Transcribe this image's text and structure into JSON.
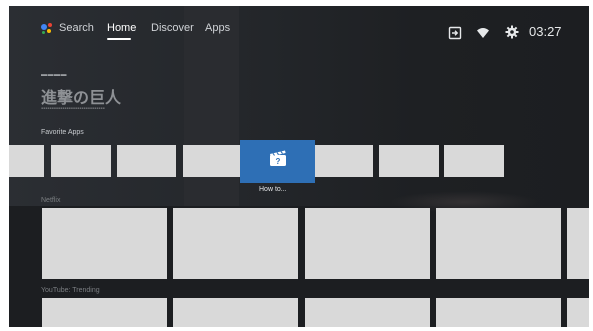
{
  "topbar": {
    "search_label": "Search",
    "tabs": [
      {
        "label": "Home",
        "active": true
      },
      {
        "label": "Discover",
        "active": false
      },
      {
        "label": "Apps",
        "active": false
      }
    ],
    "clock": "03:27"
  },
  "hero": {
    "title": "進撃の巨人"
  },
  "rows": {
    "favorite_apps": {
      "title": "Favorite Apps",
      "focused_label": "How to..."
    },
    "netflix": {
      "title": "Netflix"
    },
    "youtube": {
      "title": "YouTube: Trending"
    }
  },
  "colors": {
    "background": "#1c1e21",
    "focus_tile": "#2e6fb5",
    "placeholder": "#d9d9d9"
  },
  "icons": [
    "google-assistant-icon",
    "input-source-icon",
    "wifi-icon",
    "settings-gear-icon",
    "clapperboard-help-icon"
  ]
}
